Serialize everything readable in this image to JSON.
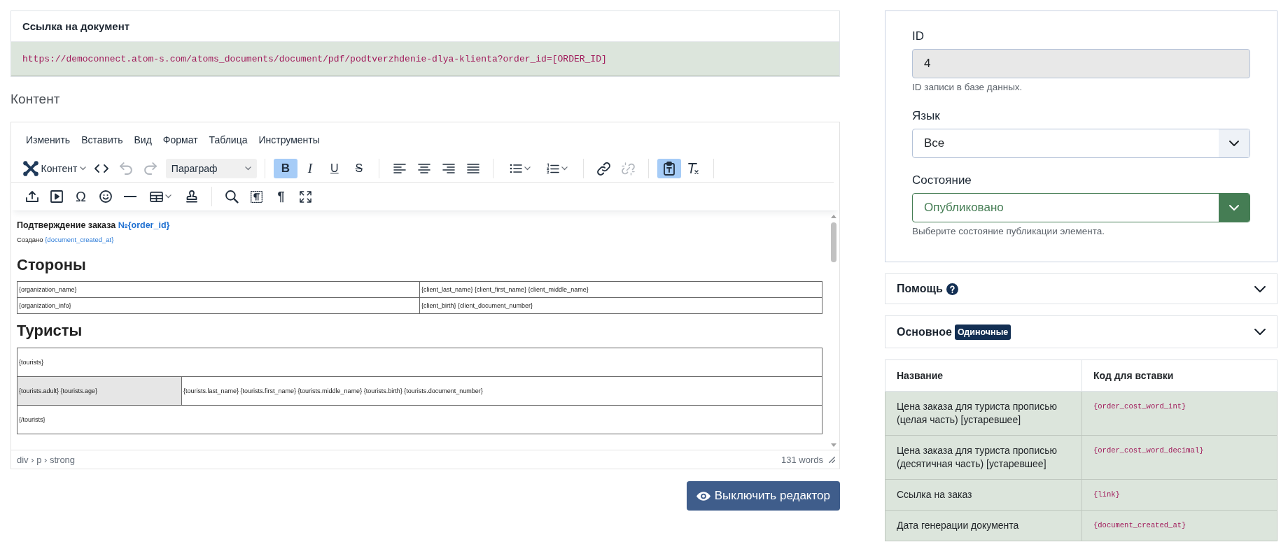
{
  "document_link": {
    "title": "Ссылка на документ",
    "url": "https://democonnect.atom-s.com/atoms_documents/document/pdf/podtverzhdenie-dlya-klienta?order_id=[ORDER_ID]"
  },
  "content_label": "Контент",
  "editor": {
    "menubar": [
      "Изменить",
      "Вставить",
      "Вид",
      "Формат",
      "Таблица",
      "Инструменты"
    ],
    "toolbar": [
      [
        [
          {
            "kind": "logo-menu",
            "label": "Контент",
            "on": false,
            "disabled": false
          },
          {
            "kind": "code",
            "on": false,
            "disabled": false
          },
          {
            "kind": "undo",
            "on": false,
            "disabled": true
          },
          {
            "kind": "redo",
            "on": false,
            "disabled": true
          },
          {
            "kind": "select",
            "label": "Параграф",
            "on": false,
            "disabled": false
          }
        ],
        [
          {
            "kind": "bold",
            "label": "B",
            "on": true,
            "disabled": false
          },
          {
            "kind": "italic",
            "label": "I",
            "on": false,
            "disabled": false
          },
          {
            "kind": "underline",
            "label": "U",
            "on": false,
            "disabled": false
          },
          {
            "kind": "strike",
            "label": "S",
            "on": false,
            "disabled": false
          }
        ],
        [
          {
            "kind": "align-left",
            "on": false,
            "disabled": false
          },
          {
            "kind": "align-center",
            "on": false,
            "disabled": false
          },
          {
            "kind": "align-right",
            "on": false,
            "disabled": false
          },
          {
            "kind": "align-justify",
            "on": false,
            "disabled": false
          }
        ],
        [
          {
            "kind": "bullist",
            "on": false,
            "disabled": false
          },
          {
            "kind": "numlist",
            "on": false,
            "disabled": false
          }
        ],
        [
          {
            "kind": "link",
            "on": false,
            "disabled": false
          },
          {
            "kind": "unlink",
            "on": false,
            "disabled": true
          }
        ],
        [
          {
            "kind": "paste-text",
            "on": true,
            "disabled": false
          },
          {
            "kind": "clear-format",
            "on": false,
            "disabled": false
          }
        ]
      ],
      [
        [
          {
            "kind": "insert",
            "on": false,
            "disabled": false
          },
          {
            "kind": "media",
            "on": false,
            "disabled": false
          },
          {
            "kind": "charmap",
            "label": "Ω",
            "on": false,
            "disabled": false
          },
          {
            "kind": "emoticons",
            "on": false,
            "disabled": false
          },
          {
            "kind": "hr",
            "on": false,
            "disabled": false
          },
          {
            "kind": "table",
            "on": false,
            "disabled": false
          },
          {
            "kind": "stamp",
            "on": false,
            "disabled": false
          }
        ],
        [
          {
            "kind": "search",
            "on": false,
            "disabled": false
          },
          {
            "kind": "visualblocks",
            "on": false,
            "disabled": false
          },
          {
            "kind": "pilcrow",
            "label": "¶",
            "on": false,
            "disabled": false
          },
          {
            "kind": "fullscreen",
            "on": false,
            "disabled": false
          }
        ]
      ]
    ],
    "document": {
      "title": {
        "text": "Подтверждение заказа",
        "tag": "№{order_id}"
      },
      "created": {
        "text": "Создано",
        "tag": "{document_created_at}"
      },
      "sections": [
        {
          "heading": "Стороны",
          "rows": [
            [
              {
                "text": "{organization_name}",
                "shaded": false
              },
              {
                "text": "{client_last_name} {client_first_name} {client_middle_name}",
                "shaded": false
              }
            ],
            [
              {
                "text": "{organization_info}",
                "shaded": false
              },
              {
                "text": "{client_birth} {client_document_number}",
                "shaded": false
              }
            ]
          ]
        },
        {
          "heading": "Туристы",
          "rows": [
            [
              {
                "text": "{tourists}",
                "shaded": false,
                "colspan": 2
              }
            ],
            [
              {
                "text": "{tourists.adult} {tourists.age}",
                "shaded": true
              },
              {
                "text": "{tourists.last_name} {tourists.first_name} {tourists.middle_name} {tourists.birth} {tourists.document_number}",
                "shaded": false
              }
            ],
            [
              {
                "text": "{/tourists}",
                "shaded": false,
                "colspan": 2
              }
            ]
          ]
        }
      ]
    },
    "status_bar": {
      "path": "div › p › strong",
      "word_count": "131 words"
    }
  },
  "editor_toggle": "Выключить редактор",
  "form": {
    "fields": [
      {
        "kind": "text",
        "label": "ID",
        "value": "4",
        "disabled": true,
        "hint": "ID записи в базе данных."
      },
      {
        "kind": "select",
        "label": "Язык",
        "value": "Все",
        "disabled": false
      },
      {
        "kind": "status",
        "label": "Состояние",
        "value": "Опубликовано",
        "disabled": false,
        "hint": "Выберите состояние публикации элемента."
      }
    ]
  },
  "panels": [
    {
      "kind": "help",
      "title": "Помощь",
      "expanded": false
    },
    {
      "kind": "plain",
      "title": "Основное",
      "badge": "Одиночные",
      "expanded": false
    }
  ],
  "variables_table": {
    "columns": [
      "Название",
      "Код для вставки"
    ],
    "rows": [
      {
        "name": "Цена заказа для туриста прописью (целая часть) [устаревшее]",
        "code": "{order_cost_word_int}"
      },
      {
        "name": "Цена заказа для туриста прописью (десятичная часть) [устаревшее]",
        "code": "{order_cost_word_decimal}"
      },
      {
        "name": "Ссылка на заказ",
        "code": "{link}"
      },
      {
        "name": "Дата генерации документа",
        "code": "{document_created_at}"
      }
    ]
  }
}
